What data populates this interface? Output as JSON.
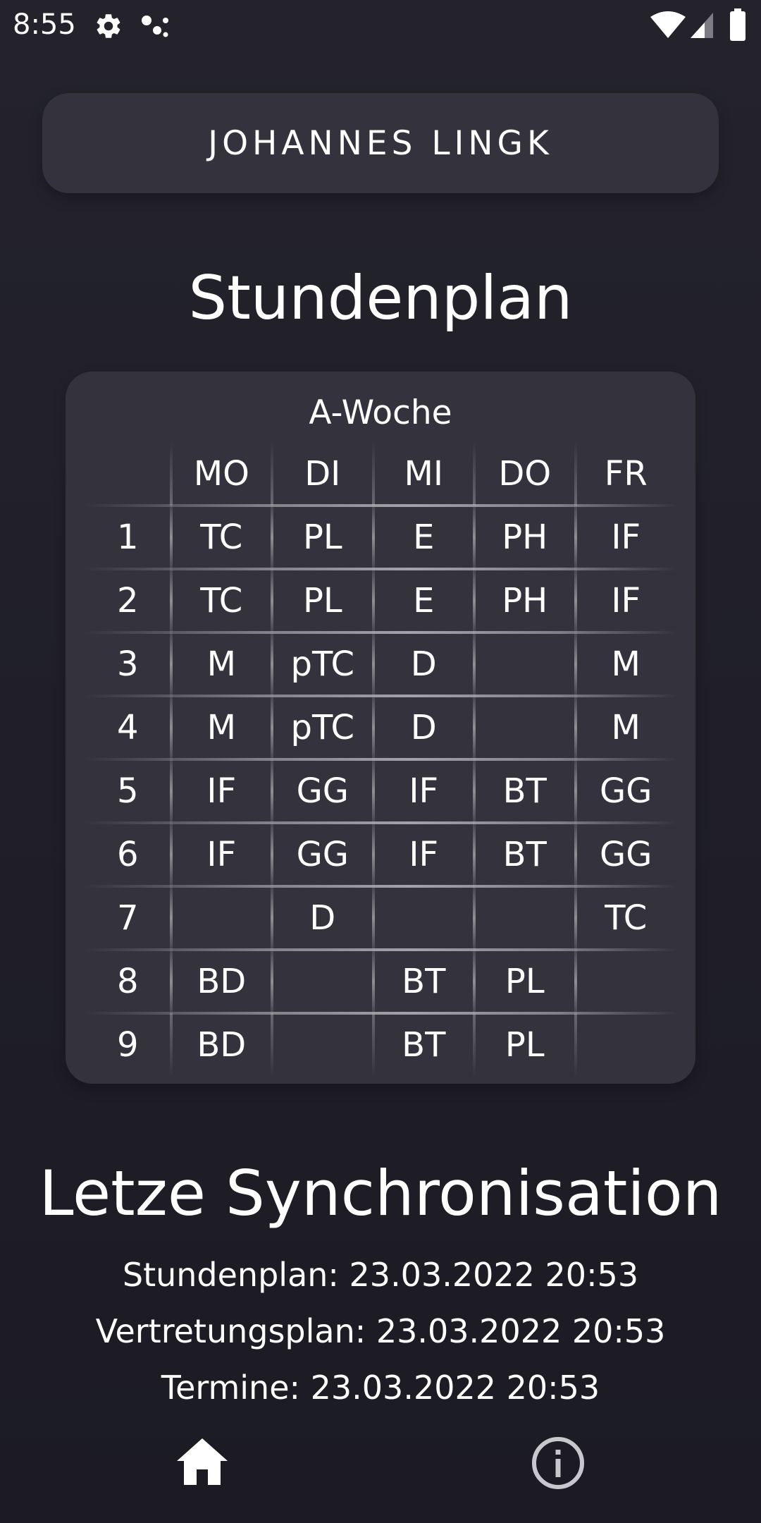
{
  "status_bar": {
    "time": "8:55",
    "icons": [
      "gear-icon",
      "assistant-dots-icon",
      "wifi-icon",
      "signal-icon",
      "battery-icon"
    ]
  },
  "profile": {
    "name": "JOHANNES LINGK"
  },
  "timetable": {
    "title": "Stundenplan",
    "week": "A-Woche",
    "days": [
      "MO",
      "DI",
      "MI",
      "DO",
      "FR"
    ],
    "rows": [
      {
        "period": "1",
        "cells": [
          "TC",
          "PL",
          "E",
          "PH",
          "IF"
        ]
      },
      {
        "period": "2",
        "cells": [
          "TC",
          "PL",
          "E",
          "PH",
          "IF"
        ]
      },
      {
        "period": "3",
        "cells": [
          "M",
          "pTC",
          "D",
          "",
          "M"
        ]
      },
      {
        "period": "4",
        "cells": [
          "M",
          "pTC",
          "D",
          "",
          "M"
        ]
      },
      {
        "period": "5",
        "cells": [
          "IF",
          "GG",
          "IF",
          "BT",
          "GG"
        ]
      },
      {
        "period": "6",
        "cells": [
          "IF",
          "GG",
          "IF",
          "BT",
          "GG"
        ]
      },
      {
        "period": "7",
        "cells": [
          "",
          "D",
          "",
          "",
          "TC"
        ]
      },
      {
        "period": "8",
        "cells": [
          "BD",
          "",
          "BT",
          "PL",
          ""
        ]
      },
      {
        "period": "9",
        "cells": [
          "BD",
          "",
          "BT",
          "PL",
          ""
        ]
      }
    ]
  },
  "sync": {
    "title": "Letze Synchronisation",
    "lines": [
      "Stundenplan: 23.03.2022 20:53",
      "Vertretungsplan: 23.03.2022 20:53",
      "Termine: 23.03.2022 20:53"
    ]
  },
  "bottom_nav": {
    "items": [
      "home-icon",
      "info-icon"
    ]
  },
  "colors": {
    "background": "#1f1e26",
    "card": "#34333d",
    "text": "#ffffff",
    "grid_line": "#b4b4b9",
    "nav_inactive": "#c8c8cc"
  }
}
